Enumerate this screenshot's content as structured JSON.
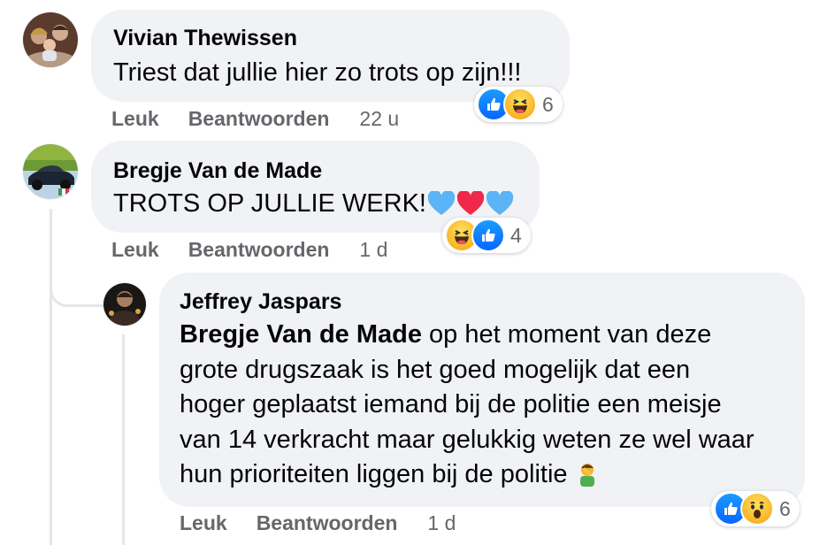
{
  "comments": [
    {
      "author": "Vivian Thewissen",
      "text": "Triest dat jullie hier zo trots op zijn!!!",
      "like_label": "Leuk",
      "reply_label": "Beantwoorden",
      "time": "22 u",
      "reactions": {
        "icons": [
          "like-icon",
          "haha-icon"
        ],
        "count": "6"
      }
    },
    {
      "author": "Bregje Van de Made",
      "text": "TROTS OP JULLIE WERK!",
      "emojis": [
        "blue-heart",
        "red-heart",
        "blue-heart"
      ],
      "like_label": "Leuk",
      "reply_label": "Beantwoorden",
      "time": "1 d",
      "reactions": {
        "icons": [
          "haha-icon",
          "like-icon"
        ],
        "count": "4"
      }
    }
  ],
  "reply": {
    "author": "Jeffrey Jaspars",
    "mention": "Bregje Van de Made",
    "lines": [
      " op het moment van deze",
      "grote drugszaak is het goed mogelijk dat een",
      "hoger geplaatst iemand bij de politie een meisje",
      "van 14 verkracht maar gelukkig weten ze wel waar",
      "hun prioriteiten liggen bij de politie "
    ],
    "emoji": "facepalm-man",
    "like_label": "Leuk",
    "reply_label": "Beantwoorden",
    "time": "1 d",
    "reactions": {
      "icons": [
        "like-icon",
        "wow-icon"
      ],
      "count": "6"
    }
  },
  "colors": {
    "bubble": "#f0f2f5",
    "secondary_text": "#65676b",
    "like_blue": "#0866ff",
    "emoji_yellow": "#f7b125",
    "heart_red": "#f02849",
    "heart_blue": "#5ab4f5",
    "thread_line": "#e4e6eb"
  }
}
